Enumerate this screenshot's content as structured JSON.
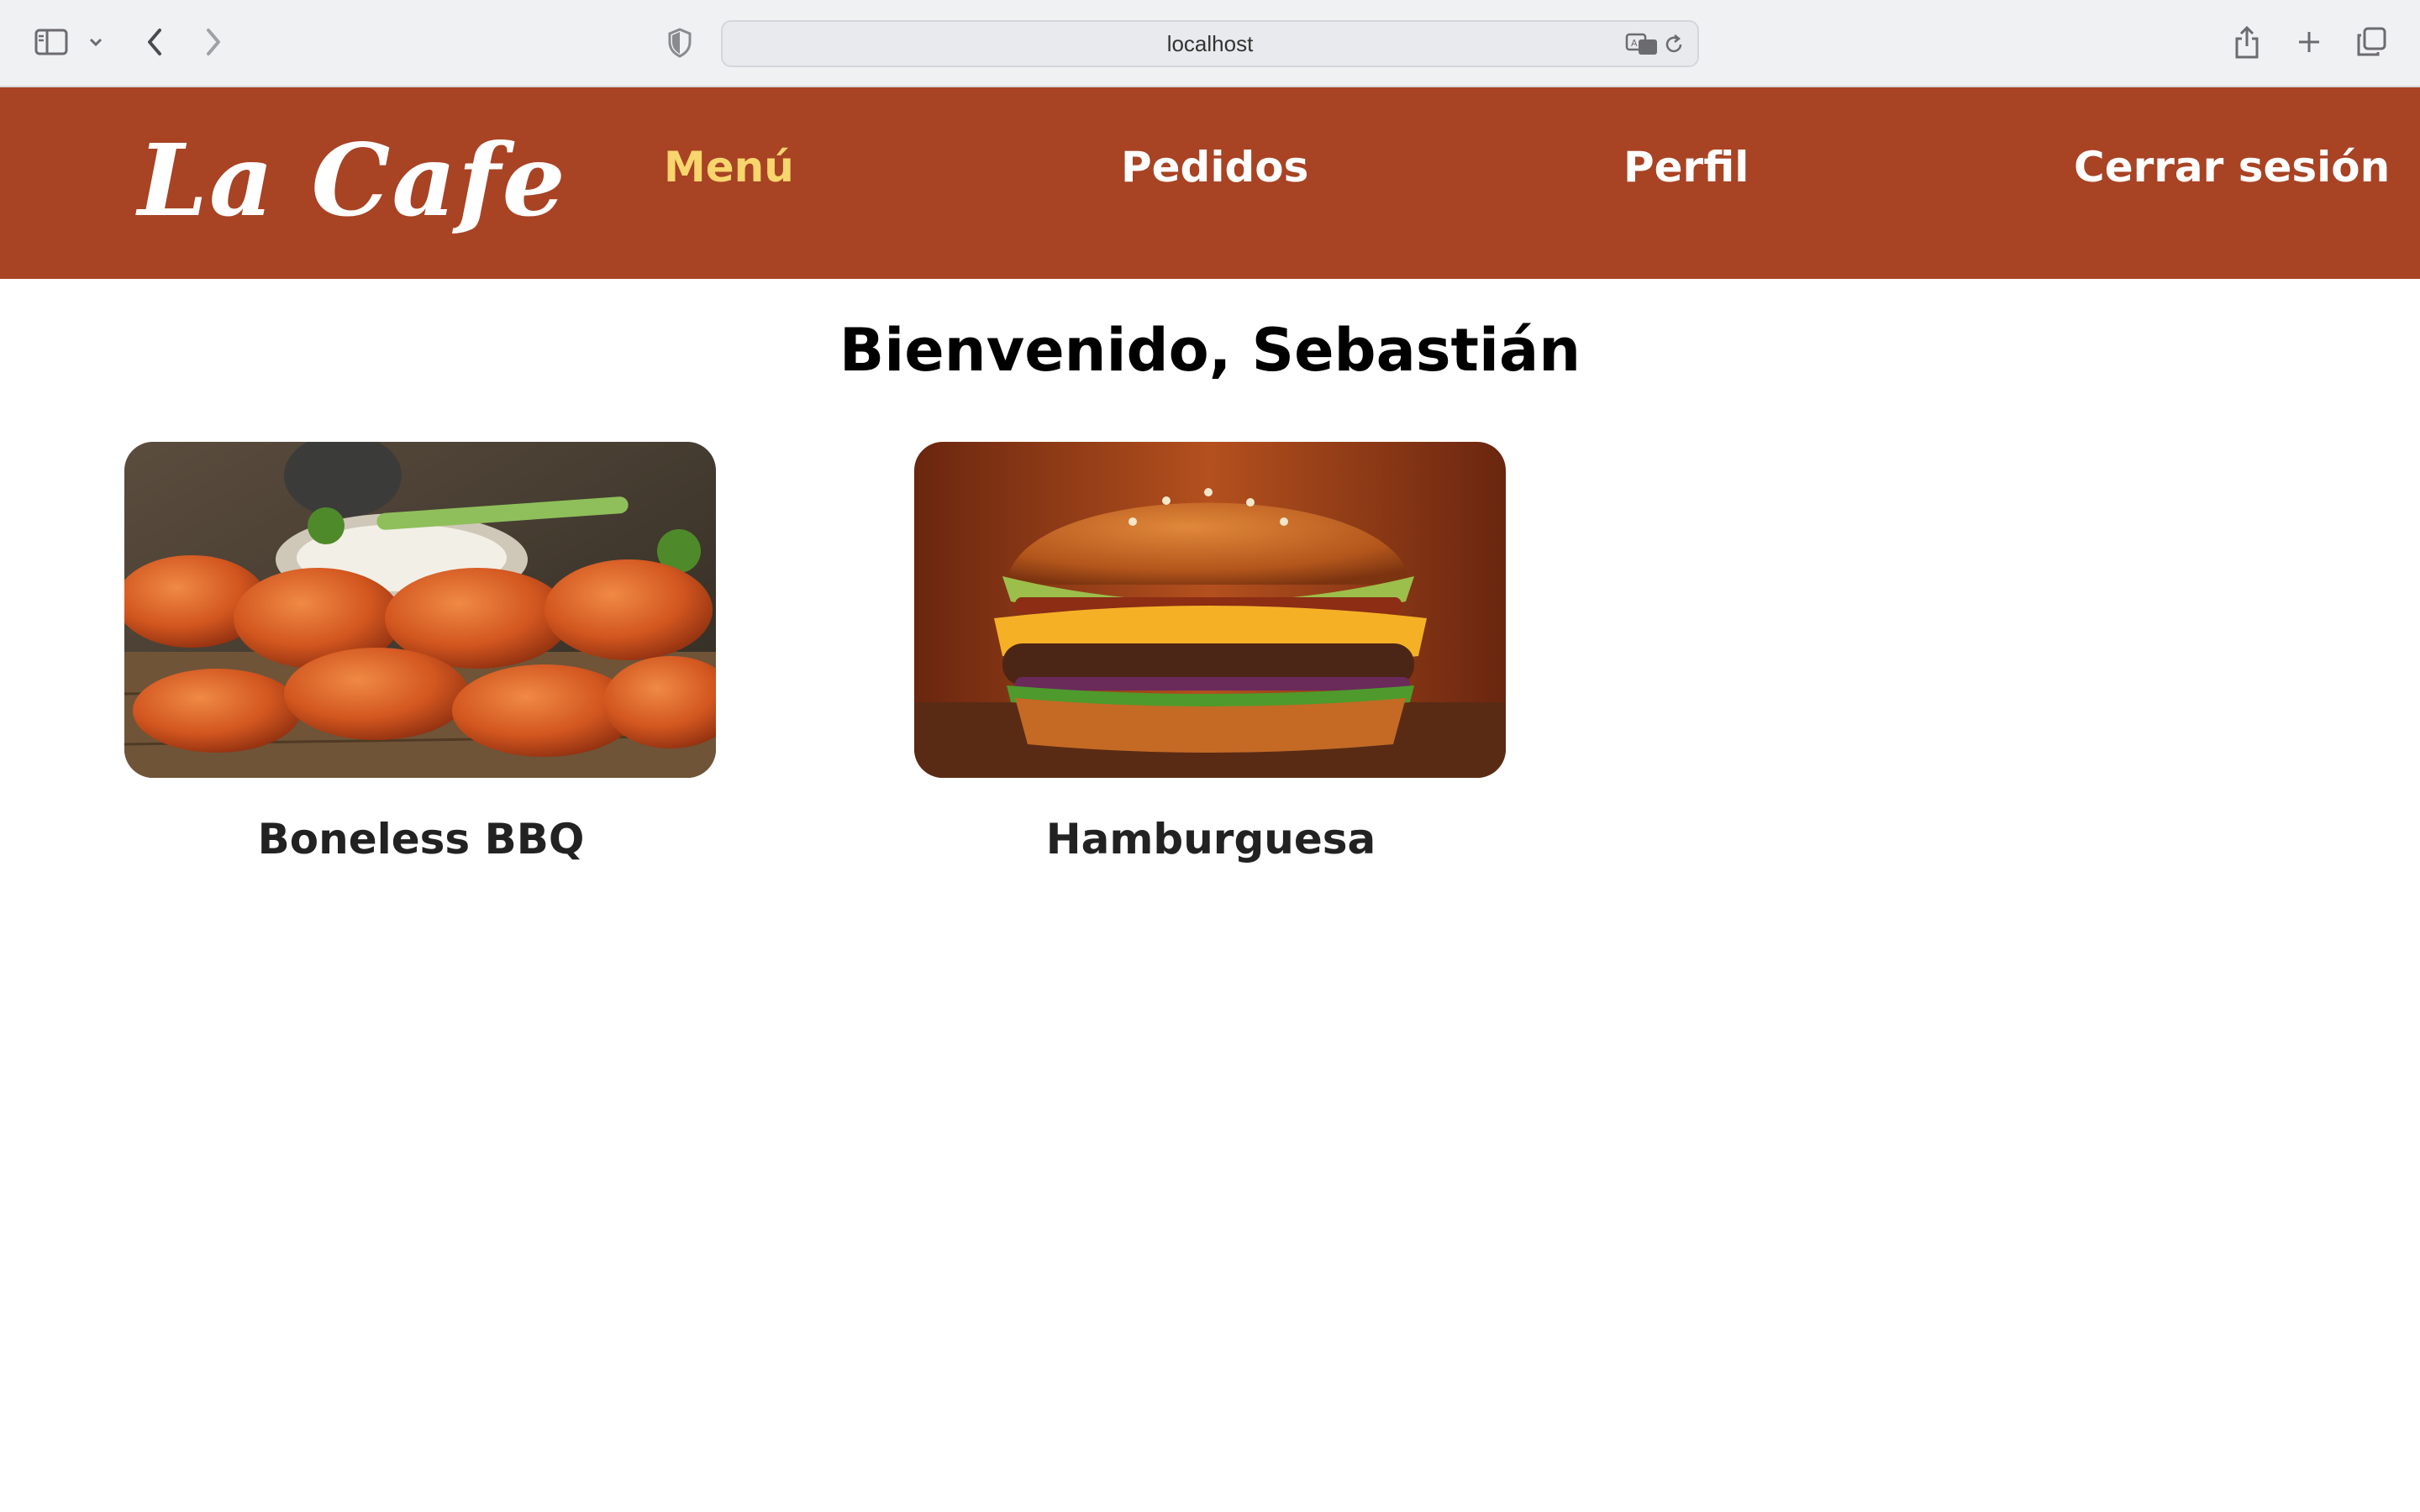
{
  "browser": {
    "url": "localhost",
    "icons": [
      "sidebar-icon",
      "chevron-down-icon",
      "back-icon",
      "forward-icon",
      "shield-icon",
      "translate-icon",
      "reload-icon",
      "share-icon",
      "plus-icon",
      "tabs-icon"
    ]
  },
  "header": {
    "logo": "La Cafe",
    "nav": {
      "menu": "Menú",
      "orders": "Pedidos",
      "profile": "Perfil",
      "logout": "Cerrar sesión"
    },
    "bg_color": "#a84324",
    "active_color": "#f9d56e"
  },
  "main": {
    "welcome": "Bienvenido, Sebastián",
    "products": [
      {
        "name": "Boneless BBQ"
      },
      {
        "name": "Hamburguesa"
      }
    ]
  }
}
